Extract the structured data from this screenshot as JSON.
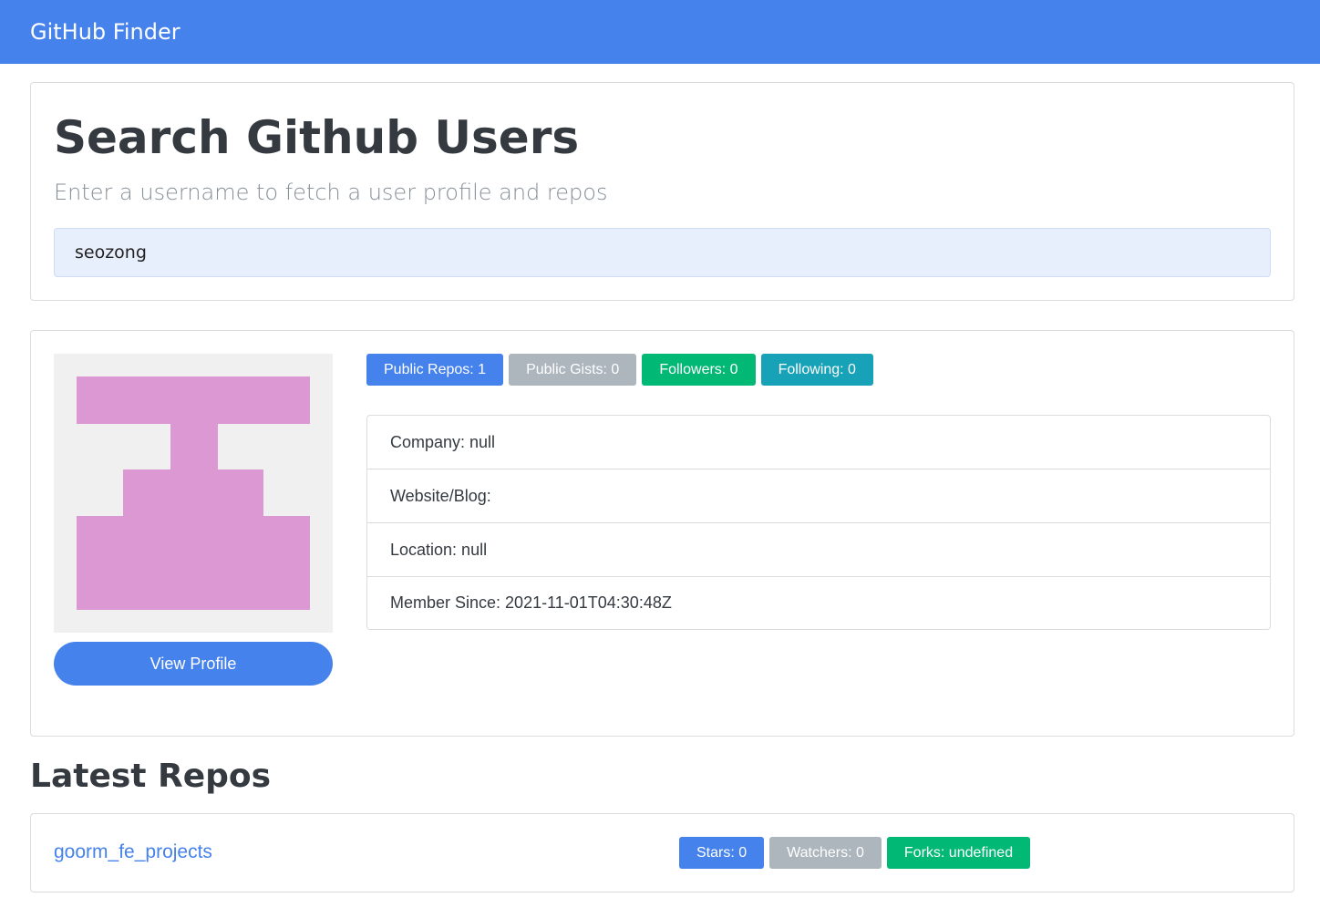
{
  "navbar": {
    "brand": "GitHub Finder"
  },
  "search": {
    "title": "Search Github Users",
    "subtitle": "Enter a username to fetch a user profile and repos",
    "value": "seozong"
  },
  "profile": {
    "avatar_color": "#db98d2",
    "avatar_bg": "#f0f0f0",
    "view_profile_label": "View Profile",
    "badges": {
      "public_repos": "Public Repos: 1",
      "public_gists": "Public Gists: 0",
      "followers": "Followers: 0",
      "following": "Following: 0"
    },
    "info": {
      "company": "Company: null",
      "website": "Website/Blog:",
      "location": "Location: null",
      "member_since": "Member Since: 2021-11-01T04:30:48Z"
    }
  },
  "repos": {
    "title": "Latest Repos",
    "items": [
      {
        "name": "goorm_fe_projects",
        "stars": "Stars: 0",
        "watchers": "Watchers: 0",
        "forks": "Forks: undefined"
      }
    ]
  },
  "colors": {
    "primary": "#4582ec",
    "secondary": "#adb5bd",
    "success": "#02b875",
    "info": "#17a2b8"
  }
}
